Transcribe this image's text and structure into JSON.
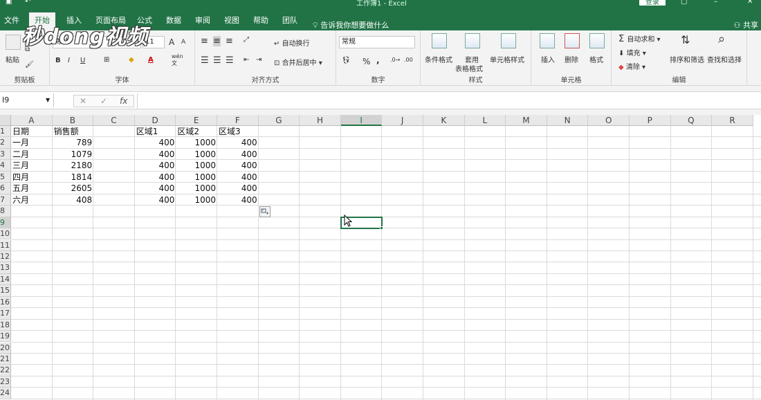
{
  "title": "工作簿1 - Excel",
  "login": "登录",
  "tabs": [
    "文件",
    "开始",
    "插入",
    "页面布局",
    "公式",
    "数据",
    "审阅",
    "视图",
    "帮助",
    "团队"
  ],
  "tell_me": "告诉我你想要做什么",
  "share": "共享",
  "watermark": "秒dong视频",
  "ribbon": {
    "clipboard": {
      "paste": "粘贴",
      "label": "剪贴板"
    },
    "font": {
      "name": "等线",
      "size": "11",
      "bold": "B",
      "italic": "I",
      "underline": "U",
      "grow": "A",
      "shrink": "A",
      "wen": "wén",
      "wen2": "文",
      "label": "字体"
    },
    "align": {
      "wrap": "自动换行",
      "merge": "合并后居中",
      "label": "对齐方式"
    },
    "number": {
      "format": "常规",
      "percent": "%",
      "comma": ",",
      "label": "数字"
    },
    "styles": {
      "cond": "条件格式",
      "table1": "套用",
      "table2": "表格格式",
      "cell": "单元格样式",
      "label": "样式"
    },
    "cells": {
      "insert": "插入",
      "delete": "删除",
      "format": "格式",
      "label": "单元格"
    },
    "editing": {
      "autosum": "自动求和",
      "fill": "填充",
      "clear": "清除",
      "sort": "排序和筛选",
      "find": "查找和选择",
      "label": "编辑"
    }
  },
  "formula_bar": {
    "name_box": "I9",
    "cancel": "✕",
    "enter": "✓",
    "fx": "fx",
    "value": ""
  },
  "columns": [
    "A",
    "B",
    "C",
    "D",
    "E",
    "F",
    "G",
    "H",
    "I",
    "J",
    "K",
    "L",
    "M",
    "N",
    "O",
    "P",
    "Q",
    "R"
  ],
  "rows": [
    "1",
    "2",
    "3",
    "4",
    "5",
    "6",
    "7",
    "8",
    "9",
    "10",
    "11",
    "12",
    "13",
    "14",
    "15",
    "16",
    "17",
    "18",
    "19",
    "20",
    "21",
    "22",
    "23",
    "24"
  ],
  "cells": {
    "A1": "日期",
    "B1": "销售额",
    "D1": "区域1",
    "E1": "区域2",
    "F1": "区域3",
    "A2": "一月",
    "B2": "789",
    "D2": "400",
    "E2": "1000",
    "F2": "400",
    "A3": "二月",
    "B3": "1079",
    "D3": "400",
    "E3": "1000",
    "F3": "400",
    "A4": "三月",
    "B4": "2180",
    "D4": "400",
    "E4": "1000",
    "F4": "400",
    "A5": "四月",
    "B5": "1814",
    "D5": "400",
    "E5": "1000",
    "F5": "400",
    "A6": "五月",
    "B6": "2605",
    "D6": "400",
    "E6": "1000",
    "F6": "400",
    "A7": "六月",
    "B7": "408",
    "D7": "400",
    "E7": "1000",
    "F7": "400"
  },
  "selected": {
    "col": "I",
    "row": "9"
  },
  "colors": {
    "accent": "#217346"
  }
}
